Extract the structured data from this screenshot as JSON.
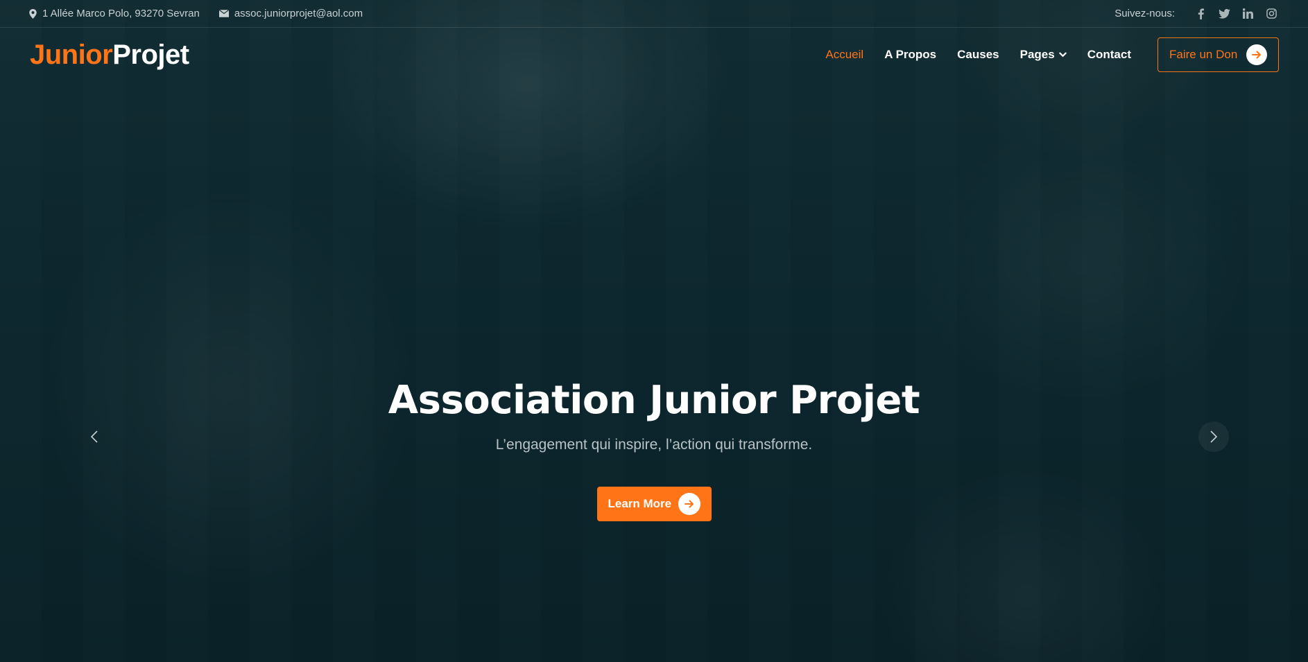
{
  "topbar": {
    "address": "1 Allée Marco Polo, 93270 Sevran",
    "email": "assoc.juniorprojet@aol.com",
    "follow_label": "Suivez-nous:",
    "social_icons": [
      "facebook-icon",
      "twitter-icon",
      "linkedin-icon",
      "instagram-icon"
    ]
  },
  "brand": {
    "part1": "Junior",
    "part2": "Projet",
    "accent_color": "#ff7417"
  },
  "nav": {
    "items": [
      {
        "label": "Accueil",
        "active": true
      },
      {
        "label": "A Propos"
      },
      {
        "label": "Causes"
      },
      {
        "label": "Pages",
        "dropdown": true
      },
      {
        "label": "Contact"
      }
    ],
    "donate_label": "Faire un Don"
  },
  "hero": {
    "title": "Association Junior Projet",
    "subtitle": "L’engagement qui inspire, l’action qui transforme.",
    "cta_label": "Learn More"
  }
}
